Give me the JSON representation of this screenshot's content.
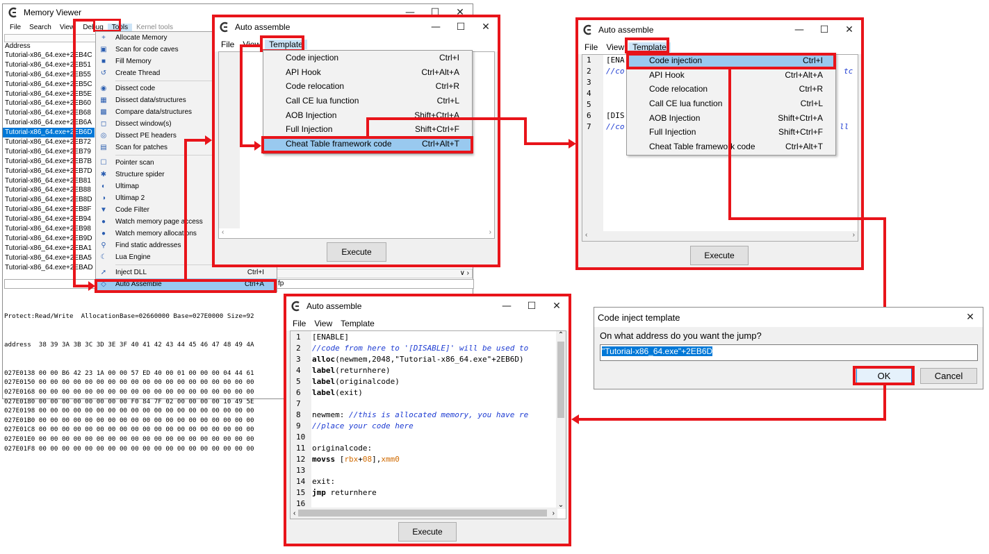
{
  "memory_viewer": {
    "title": "Memory Viewer",
    "menu": [
      "File",
      "Search",
      "View",
      "Debug",
      "Tools",
      "Kernel tools"
    ],
    "address_header": "Address",
    "rows": [
      "Tutorial-x86_64.exe+2EB4C",
      "Tutorial-x86_64.exe+2EB51",
      "Tutorial-x86_64.exe+2EB55",
      "Tutorial-x86_64.exe+2EB5C",
      "Tutorial-x86_64.exe+2EB5E",
      "Tutorial-x86_64.exe+2EB60",
      "Tutorial-x86_64.exe+2EB68",
      "Tutorial-x86_64.exe+2EB6A",
      "Tutorial-x86_64.exe+2EB6D",
      "Tutorial-x86_64.exe+2EB72",
      "Tutorial-x86_64.exe+2EB79",
      "Tutorial-x86_64.exe+2EB7B",
      "Tutorial-x86_64.exe+2EB7D",
      "Tutorial-x86_64.exe+2EB81",
      "Tutorial-x86_64.exe+2EB88",
      "Tutorial-x86_64.exe+2EB8D",
      "Tutorial-x86_64.exe+2EB8F",
      "Tutorial-x86_64.exe+2EB94",
      "Tutorial-x86_64.exe+2EB98",
      "Tutorial-x86_64.exe+2EB9D",
      "Tutorial-x86_64.exe+2EBA1",
      "Tutorial-x86_64.exe+2EBA5",
      "Tutorial-x86_64.exe+2EBAD"
    ],
    "selected_row": "Tutorial-x86_64.exe+2EB6D",
    "protect_line": "Protect:Read/Write  AllocationBase=02660000 Base=027E0000 Size=92",
    "hex_header": "address  38 39 3A 3B 3C 3D 3E 3F 40 41 42 43 44 45 46 47 48 49 4A",
    "hex_rows": [
      "027E0138 00 00 B6 42 23 1A 00 00 57 ED 40 00 01 00 00 00 04 44 61",
      "027E0150 00 00 00 00 00 00 00 00 00 00 00 00 00 00 00 00 00 00 00",
      "027E0168 00 00 00 00 00 00 00 00 00 00 00 00 00 00 00 00 00 00 00",
      "027E0180 00 00 00 00 00 00 00 00 F0 84 7F 02 00 00 00 00 10 49 5E",
      "027E0198 00 00 00 00 00 00 00 00 00 00 00 00 00 00 00 00 00 00 00",
      "027E01B0 00 00 00 00 00 00 00 00 00 00 00 00 00 00 00 00 00 00 00",
      "027E01C8 00 00 00 00 00 00 00 00 00 00 00 00 00 00 00 00 00 00 00",
      "027E01E0 00 00 00 00 00 00 00 00 00 00 00 00 00 00 00 00 00 00 00",
      "027E01F8 00 00 00 00 00 00 00 00 00 00 00 00 00 00 00 00 00 00 00"
    ],
    "fp_fragment": "fp"
  },
  "tools_menu": {
    "items": [
      {
        "icon": "plus-icon",
        "label": "Allocate Memory",
        "shortcut": ""
      },
      {
        "icon": "scan-caves-icon",
        "label": "Scan for code caves",
        "shortcut": ""
      },
      {
        "icon": "fill-icon",
        "label": "Fill Memory",
        "shortcut": ""
      },
      {
        "icon": "thread-icon",
        "label": "Create Thread",
        "shortcut": ""
      },
      {
        "sep": true
      },
      {
        "icon": "eye-icon",
        "label": "Dissect code",
        "shortcut": ""
      },
      {
        "icon": "structure-icon",
        "label": "Dissect data/structures",
        "shortcut": ""
      },
      {
        "icon": "compare-icon",
        "label": "Compare data/structures",
        "shortcut": ""
      },
      {
        "icon": "window-icon",
        "label": "Dissect window(s)",
        "shortcut": ""
      },
      {
        "icon": "pe-icon",
        "label": "Dissect PE headers",
        "shortcut": ""
      },
      {
        "icon": "patch-icon",
        "label": "Scan for patches",
        "shortcut": ""
      },
      {
        "sep": true
      },
      {
        "icon": "pointer-icon",
        "label": "Pointer scan",
        "shortcut": ""
      },
      {
        "icon": "spider-icon",
        "label": "Structure spider",
        "shortcut": ""
      },
      {
        "icon": "ultimap-icon",
        "label": "Ultimap",
        "shortcut": ""
      },
      {
        "icon": "ultimap2-icon",
        "label": "Ultimap 2",
        "shortcut": ""
      },
      {
        "icon": "filter-icon",
        "label": "Code Filter",
        "shortcut": ""
      },
      {
        "icon": "watch-icon",
        "label": "Watch memory page access",
        "shortcut": ""
      },
      {
        "icon": "watch-alloc-icon",
        "label": "Watch memory allocations",
        "shortcut": ""
      },
      {
        "icon": "find-icon",
        "label": "Find static addresses",
        "shortcut": ""
      },
      {
        "icon": "lua-icon",
        "label": "Lua Engine",
        "shortcut": ""
      },
      {
        "sep": true
      },
      {
        "icon": "syringe-icon",
        "label": "Inject DLL",
        "shortcut": "Ctrl+I"
      },
      {
        "icon": "assemble-icon",
        "label": "Auto Assemble",
        "shortcut": "Ctrl+A",
        "selected": true
      }
    ]
  },
  "auto_assemble_1": {
    "title": "Auto assemble",
    "menu": [
      "File",
      "View",
      "Template"
    ],
    "template_items": [
      {
        "label": "Code injection",
        "shortcut": "Ctrl+I"
      },
      {
        "label": "API Hook",
        "shortcut": "Ctrl+Alt+A"
      },
      {
        "label": "Code relocation",
        "shortcut": "Ctrl+R"
      },
      {
        "label": "Call CE lua function",
        "shortcut": "Ctrl+L"
      },
      {
        "label": "AOB Injection",
        "shortcut": "Shift+Ctrl+A"
      },
      {
        "label": "Full Injection",
        "shortcut": "Shift+Ctrl+F"
      },
      {
        "label": "Cheat Table framework code",
        "shortcut": "Ctrl+Alt+T"
      }
    ],
    "execute": "Execute"
  },
  "auto_assemble_2": {
    "title": "Auto assemble",
    "menu": [
      "File",
      "View",
      "Template"
    ],
    "gutter": [
      "1",
      "2",
      "3",
      "4",
      "5",
      "6",
      "7"
    ],
    "code_fragments": [
      "[ENA",
      "//co",
      "tc",
      "[DIS",
      "//co",
      "ll"
    ],
    "template_items": [
      {
        "label": "Code injection",
        "shortcut": "Ctrl+I"
      },
      {
        "label": "API Hook",
        "shortcut": "Ctrl+Alt+A"
      },
      {
        "label": "Code relocation",
        "shortcut": "Ctrl+R"
      },
      {
        "label": "Call CE lua function",
        "shortcut": "Ctrl+L"
      },
      {
        "label": "AOB Injection",
        "shortcut": "Shift+Ctrl+A"
      },
      {
        "label": "Full Injection",
        "shortcut": "Shift+Ctrl+F"
      },
      {
        "label": "Cheat Table framework code",
        "shortcut": "Ctrl+Alt+T"
      }
    ],
    "execute": "Execute"
  },
  "code_inject_dialog": {
    "title": "Code inject template",
    "question": "On what address do you want the jump?",
    "value": "\"Tutorial-x86_64.exe\"+2EB6D",
    "ok": "OK",
    "cancel": "Cancel"
  },
  "auto_assemble_3": {
    "title": "Auto assemble",
    "menu": [
      "File",
      "View",
      "Template"
    ],
    "lines": [
      {
        "n": "1",
        "t": "[ENABLE]"
      },
      {
        "n": "2",
        "t": "//code from here to '[DISABLE]' will be used to"
      },
      {
        "n": "3",
        "t": "alloc(newmem,2048,\"Tutorial-x86_64.exe\"+2EB6D)"
      },
      {
        "n": "4",
        "t": "label(returnhere)"
      },
      {
        "n": "5",
        "t": "label(originalcode)"
      },
      {
        "n": "6",
        "t": "label(exit)"
      },
      {
        "n": "7",
        "t": ""
      },
      {
        "n": "8",
        "t": "newmem: //this is allocated memory, you have re"
      },
      {
        "n": "9",
        "t": "//place your code here"
      },
      {
        "n": "10",
        "t": ""
      },
      {
        "n": "11",
        "t": "originalcode:"
      },
      {
        "n": "12",
        "t": "movss [rbx+08],xmm0"
      },
      {
        "n": "13",
        "t": ""
      },
      {
        "n": "14",
        "t": "exit:"
      },
      {
        "n": "15",
        "t": "jmp returnhere"
      },
      {
        "n": "16",
        "t": ""
      }
    ],
    "execute": "Execute"
  },
  "colors": {
    "highlight": "#e8141a",
    "selection": "#99c9ef",
    "comment": "#1e3cd2"
  }
}
